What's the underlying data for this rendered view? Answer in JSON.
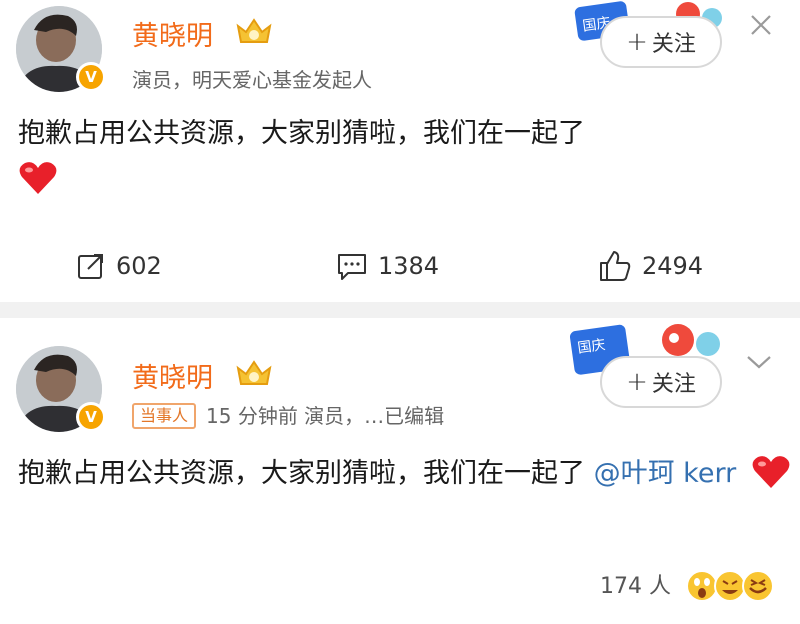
{
  "post1": {
    "author": "黄晓明",
    "bio": "演员，明天爱心基金发起人",
    "follow_label": "关注",
    "text": "抱歉占用公共资源，大家别猜啦，我们在一起了",
    "repost_count": "602",
    "comment_count": "1384",
    "like_count": "2494"
  },
  "post2": {
    "author": "黄晓明",
    "tag": "当事人",
    "meta": "15 分钟前  演员，…已编辑",
    "follow_label": "关注",
    "text": "抱歉占用公共资源，大家别猜啦，我们在一起了",
    "mention": "@叶珂 kerr",
    "reaction_count": "174 人"
  },
  "colors": {
    "name": "#f26b1a",
    "link": "#3570b0",
    "badge": "#f7a400"
  },
  "icons": [
    "close-icon",
    "chevron-down-icon",
    "repost-icon",
    "comment-icon",
    "like-icon",
    "heart-icon",
    "crown-icon",
    "verified-icon"
  ]
}
